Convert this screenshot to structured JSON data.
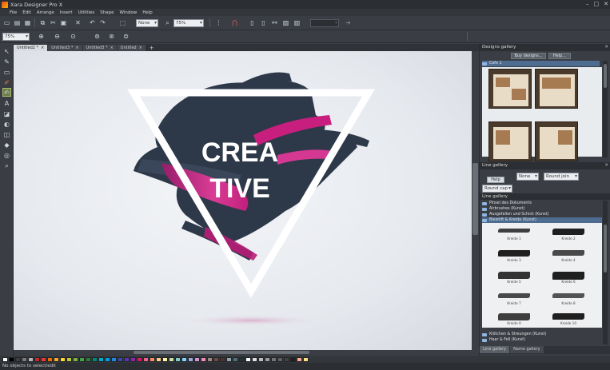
{
  "app": {
    "title": "Xara Designer Pro X"
  },
  "window_controls": {
    "minimize": "–",
    "maximize": "□",
    "close": "✕"
  },
  "menu": [
    "File",
    "Edit",
    "Arrange",
    "Insert",
    "Utilities",
    "Shape",
    "Window",
    "Help"
  ],
  "toolbar": {
    "line_style_value": "None",
    "zoom_value": "75%",
    "zoom_value_2": "75%"
  },
  "tabs": [
    {
      "label": "Untitled2 *",
      "active": true
    },
    {
      "label": "Untitled3 *",
      "active": false
    },
    {
      "label": "Untitled3 *",
      "active": false
    },
    {
      "label": "Untitled",
      "active": false
    }
  ],
  "tab_add": "+",
  "canvas": {
    "line1": "CREA",
    "line2": "TIVE"
  },
  "designs_gallery": {
    "title": "Designs gallery",
    "close": "✕",
    "buy_designs_label": "Buy designs...",
    "help_label": "Help...",
    "folder": "Cafe 1"
  },
  "line_gallery": {
    "title": "Line gallery",
    "close": "✕",
    "help_label": "Help",
    "cap_value": "None",
    "join_value": "Round join",
    "round_cap_value": "Round cap",
    "section_title": "Line gallery",
    "folders": [
      "Pinsel des Dokuments",
      "Airbrushes (Kunst)",
      "Ausgefallen und Schick (Kunst)",
      "Bleistift & Kreide (Kunst)"
    ],
    "selected_folder_index": 3,
    "strokes": [
      "Kreide 1",
      "Kreide 2",
      "Kreide 3",
      "Kreide 4",
      "Kreide 5",
      "Kreide 6",
      "Kreide 7",
      "Kreide 8",
      "Kreide 9",
      "Kreide 10"
    ],
    "bottom_folders": [
      "Klötchen & Streungen (Kunst)",
      "Haar & Fell (Kunst)"
    ]
  },
  "panel_tabs": [
    "Line gallery",
    "Name gallery"
  ],
  "palette_colors": [
    "#ffffff",
    "#000000",
    "#3d3d3d",
    "#7a7a7a",
    "#b5b5b5",
    "#c62828",
    "#e53935",
    "#ef6c00",
    "#f9a825",
    "#fdd835",
    "#c0ca33",
    "#7cb342",
    "#43a047",
    "#2e7d32",
    "#00897b",
    "#00acc1",
    "#039be5",
    "#1e88e5",
    "#3949ab",
    "#5e35b1",
    "#8e24aa",
    "#d81b60",
    "#f06292",
    "#ff8a65",
    "#ffcc80",
    "#fff59d",
    "#c5e1a5",
    "#80cbc4",
    "#81d4fa",
    "#9fa8da",
    "#ce93d8",
    "#f48fb1",
    "#a1887f",
    "#6d4c41",
    "#4e342e",
    "#90a4ae",
    "#546e7a",
    "#263238",
    "#ffffff",
    "#e0e0e0",
    "#bdbdbd",
    "#9e9e9e",
    "#757575",
    "#616161",
    "#424242",
    "#212121",
    "#ffab91",
    "#ffe082"
  ],
  "status": {
    "text": "No objects to select/edit"
  },
  "colors": {
    "brush_navy": "#2d3848",
    "brush_magenta": "#c81f7f",
    "brush_pink": "#e8399a"
  }
}
